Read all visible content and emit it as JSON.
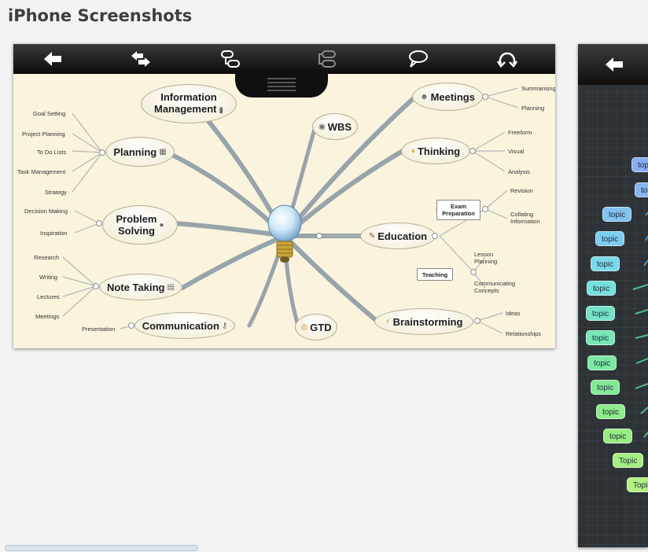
{
  "page": {
    "heading": "iPhone Screenshots"
  },
  "screenshot1": {
    "toolbar_icons": [
      "back-arrow-icon",
      "reply-share-icon",
      "node-link-icon",
      "node-stack-icon",
      "speech-bubble-icon",
      "rotate-icon"
    ],
    "nodes": {
      "information_management": [
        "Information",
        "Management"
      ],
      "planning": "Planning",
      "problem_solving": [
        "Problem",
        "Solving"
      ],
      "note_taking": "Note Taking",
      "communication": "Communication",
      "wbs": "WBS",
      "gtd": "GTD",
      "meetings": "Meetings",
      "thinking": "Thinking",
      "education": "Education",
      "brainstorming": "Brainstorming"
    },
    "leaves": {
      "planning": [
        "Goal Setting",
        "Project Planning",
        "To Do Lists",
        "Task Management",
        "Strategy"
      ],
      "problem_solving": [
        "Decision Making",
        "Inspiration"
      ],
      "note_taking": [
        "Research",
        "Writing",
        "Lectures",
        "Meetings"
      ],
      "communication": [
        "Presentation"
      ],
      "meetings": [
        "Summarising",
        "Planning"
      ],
      "thinking": [
        "Freeform",
        "Visual",
        "Analysis"
      ],
      "exam_preparation": [
        "Revision",
        "Collating Information"
      ],
      "teaching": [
        "Lesson Planning",
        "Communicating Concepts"
      ],
      "brainstorming": [
        "Ideas",
        "Relationships"
      ]
    },
    "boxes": {
      "exam_preparation": [
        "Exam",
        "Preparation"
      ],
      "teaching": "Teaching"
    }
  },
  "screenshot2": {
    "topics": [
      "topic",
      "topic",
      "topic",
      "topic",
      "topic",
      "topic",
      "topic",
      "topic",
      "topic",
      "topic",
      "topic",
      "topic",
      "Topic",
      "Topic"
    ],
    "colors": [
      "#88aef0",
      "#88b4f0",
      "#82c2f0",
      "#7ccdee",
      "#7ad8ea",
      "#76e0dc",
      "#76e3c9",
      "#78e6b6",
      "#7ce8a4",
      "#84ea96",
      "#8deb8b",
      "#98ec84",
      "#a6ee82",
      "#b4ef82"
    ]
  },
  "colors": {
    "toolbar": "#111111",
    "map_background": "#faf3dd",
    "branch": "#97a4a9",
    "dark_canvas": "#2d3236"
  }
}
